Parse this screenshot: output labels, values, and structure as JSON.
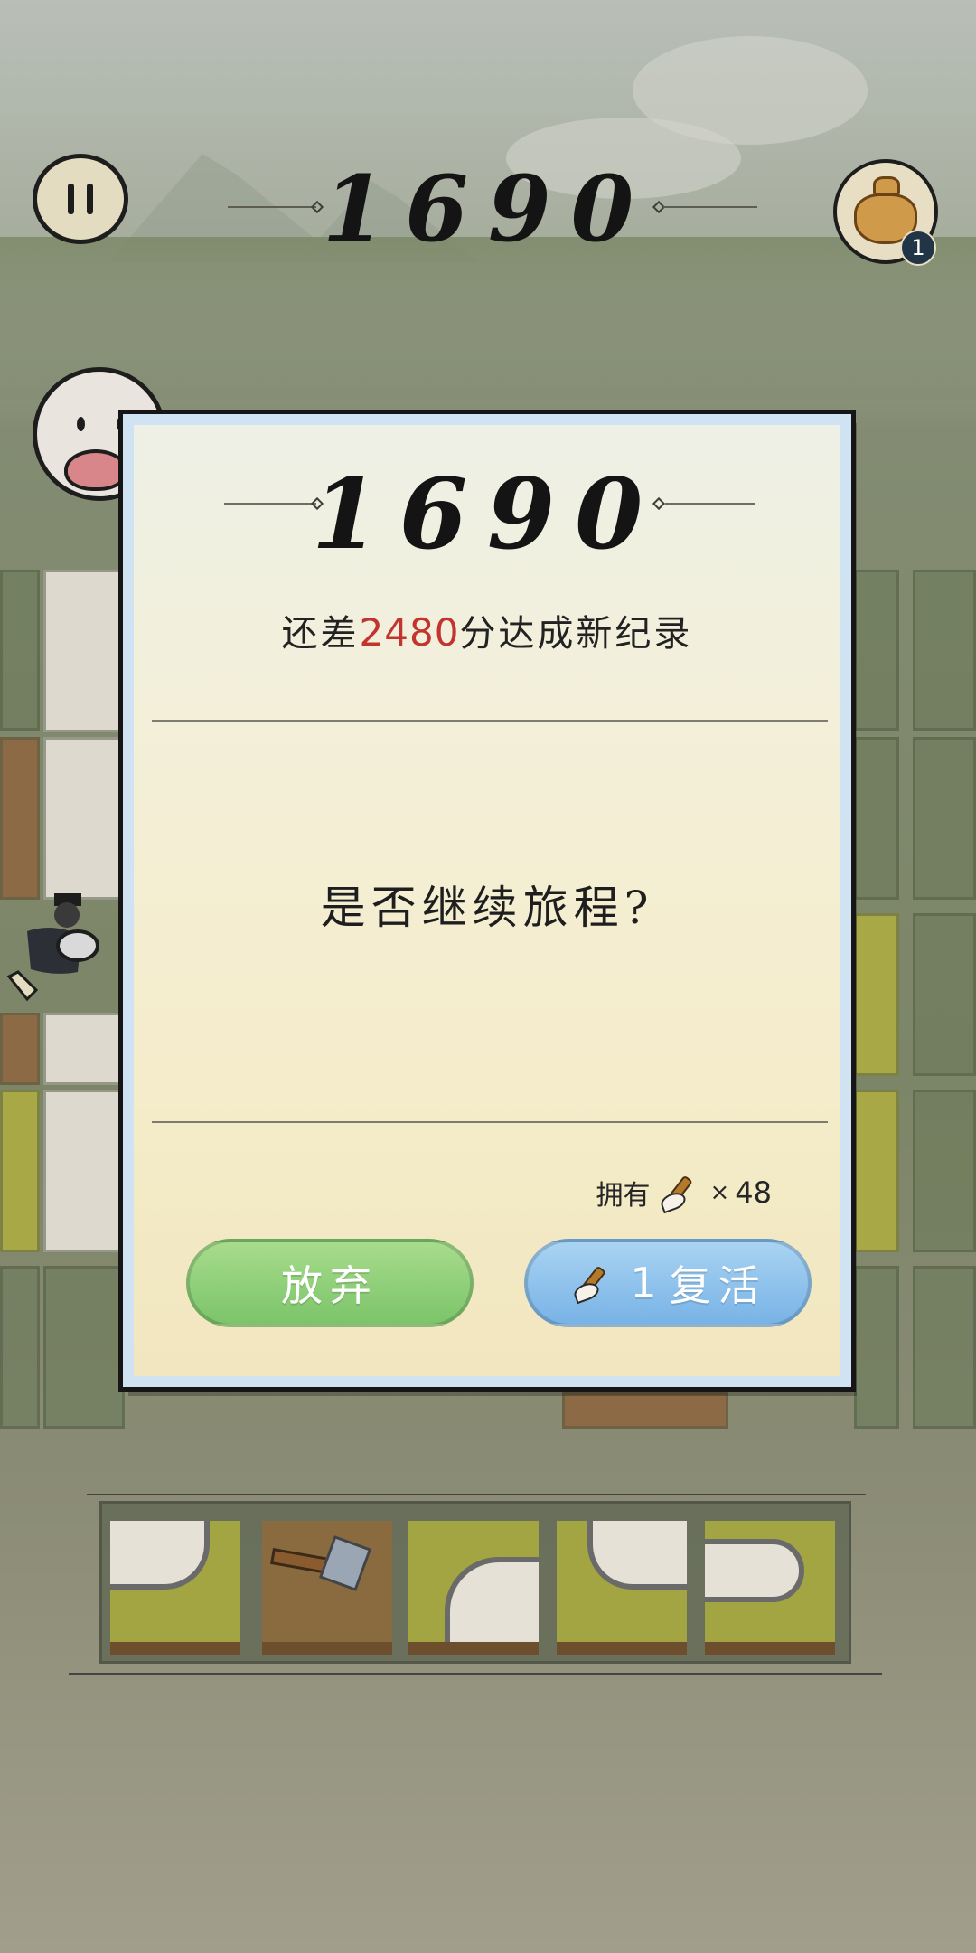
{
  "hud": {
    "score": "1690",
    "bag_badge": "1",
    "pause_icon": "pause-icon",
    "bag_icon": "bag-icon"
  },
  "dialog": {
    "score": "1690",
    "record_prefix": "还差",
    "record_points": "2480",
    "record_suffix": "分达成新纪录",
    "question": "是否继续旅程?",
    "own_label": "拥有",
    "own_times": "×",
    "own_count": "48",
    "giveup_label": "放弃",
    "revive_cost": "1",
    "revive_label": "复活",
    "brush_icon": "brush-icon"
  },
  "colors": {
    "record_points": "#c2342e",
    "giveup_button": "#8fcf78",
    "revive_button": "#8ec3ec",
    "dialog_border": "#cfe3f2"
  }
}
